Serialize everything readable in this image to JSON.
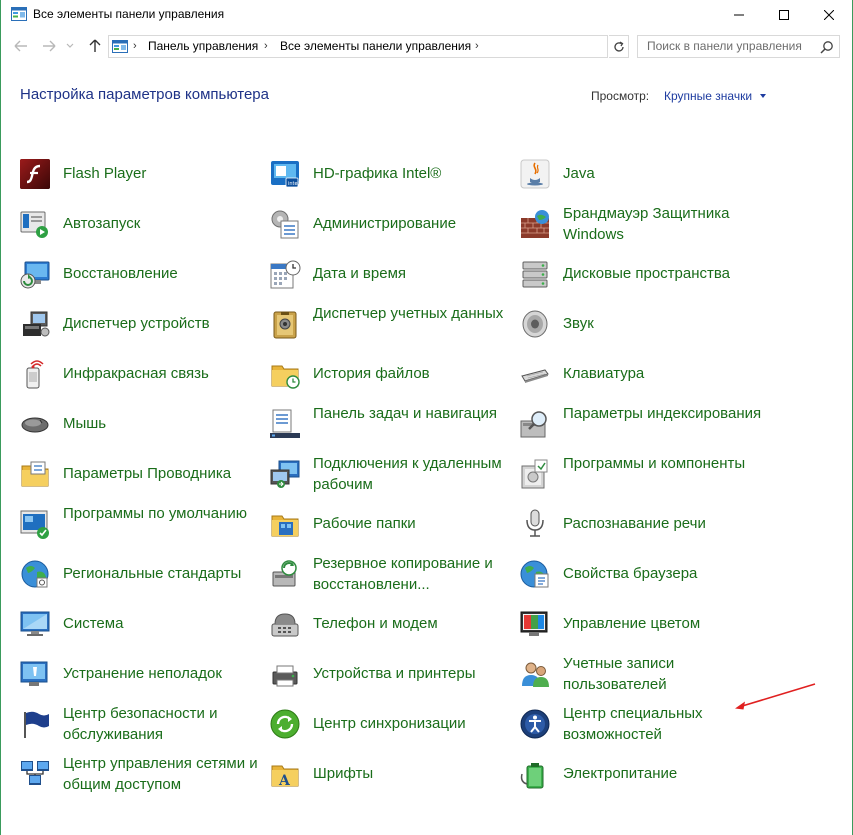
{
  "window": {
    "title": "Все элементы панели управления"
  },
  "address": {
    "breadcrumbs": [
      "Панель управления",
      "Все элементы панели управления"
    ],
    "search_placeholder": "Поиск в панели управления"
  },
  "header": {
    "title": "Настройка параметров компьютера",
    "view_label": "Просмотр:",
    "view_value": "Крупные значки"
  },
  "items": [
    {
      "label": "Flash Player",
      "icon": "flash-player-icon"
    },
    {
      "label": "HD-графика Intel®",
      "icon": "intel-graphics-icon"
    },
    {
      "label": "Java",
      "icon": "java-icon"
    },
    {
      "label": "Автозапуск",
      "icon": "autoplay-icon"
    },
    {
      "label": "Администрирование",
      "icon": "administrative-tools-icon"
    },
    {
      "label": "Брандмауэр Защитника Windows",
      "icon": "firewall-icon"
    },
    {
      "label": "Восстановление",
      "icon": "recovery-icon"
    },
    {
      "label": "Дата и время",
      "icon": "date-time-icon"
    },
    {
      "label": "Дисковые пространства",
      "icon": "storage-spaces-icon"
    },
    {
      "label": "Диспетчер устройств",
      "icon": "device-manager-icon"
    },
    {
      "label": "Диспетчер учетных данных",
      "icon": "credential-manager-icon"
    },
    {
      "label": "Звук",
      "icon": "sound-icon"
    },
    {
      "label": "Инфракрасная связь",
      "icon": "infrared-icon"
    },
    {
      "label": "История файлов",
      "icon": "file-history-icon"
    },
    {
      "label": "Клавиатура",
      "icon": "keyboard-icon"
    },
    {
      "label": "Мышь",
      "icon": "mouse-icon"
    },
    {
      "label": "Панель задач и навигация",
      "icon": "taskbar-icon"
    },
    {
      "label": "Параметры индексирования",
      "icon": "indexing-options-icon"
    },
    {
      "label": "Параметры Проводника",
      "icon": "explorer-options-icon"
    },
    {
      "label": "Подключения к удаленным рабочим",
      "icon": "remote-desktop-icon"
    },
    {
      "label": "Программы и компоненты",
      "icon": "programs-features-icon"
    },
    {
      "label": "Программы по умолчанию",
      "icon": "default-programs-icon"
    },
    {
      "label": "Рабочие папки",
      "icon": "work-folders-icon"
    },
    {
      "label": "Распознавание речи",
      "icon": "speech-recognition-icon"
    },
    {
      "label": "Региональные стандарты",
      "icon": "region-icon"
    },
    {
      "label": "Резервное копирование и восстановлени...",
      "icon": "backup-restore-icon"
    },
    {
      "label": "Свойства браузера",
      "icon": "internet-options-icon"
    },
    {
      "label": "Система",
      "icon": "system-icon"
    },
    {
      "label": "Телефон и модем",
      "icon": "phone-modem-icon"
    },
    {
      "label": "Управление цветом",
      "icon": "color-management-icon"
    },
    {
      "label": "Устранение неполадок",
      "icon": "troubleshooting-icon"
    },
    {
      "label": "Устройства и принтеры",
      "icon": "devices-printers-icon"
    },
    {
      "label": "Учетные записи пользователей",
      "icon": "user-accounts-icon"
    },
    {
      "label": "Центр безопасности и обслуживания",
      "icon": "security-maintenance-icon"
    },
    {
      "label": "Центр синхронизации",
      "icon": "sync-center-icon"
    },
    {
      "label": "Центр специальных возможностей",
      "icon": "ease-of-access-icon"
    },
    {
      "label": "Центр управления сетями и общим доступом",
      "icon": "network-sharing-icon"
    },
    {
      "label": "Шрифты",
      "icon": "fonts-icon"
    },
    {
      "label": "Электропитание",
      "icon": "power-options-icon"
    }
  ],
  "annotation": {
    "arrow_color": "#e02020"
  }
}
